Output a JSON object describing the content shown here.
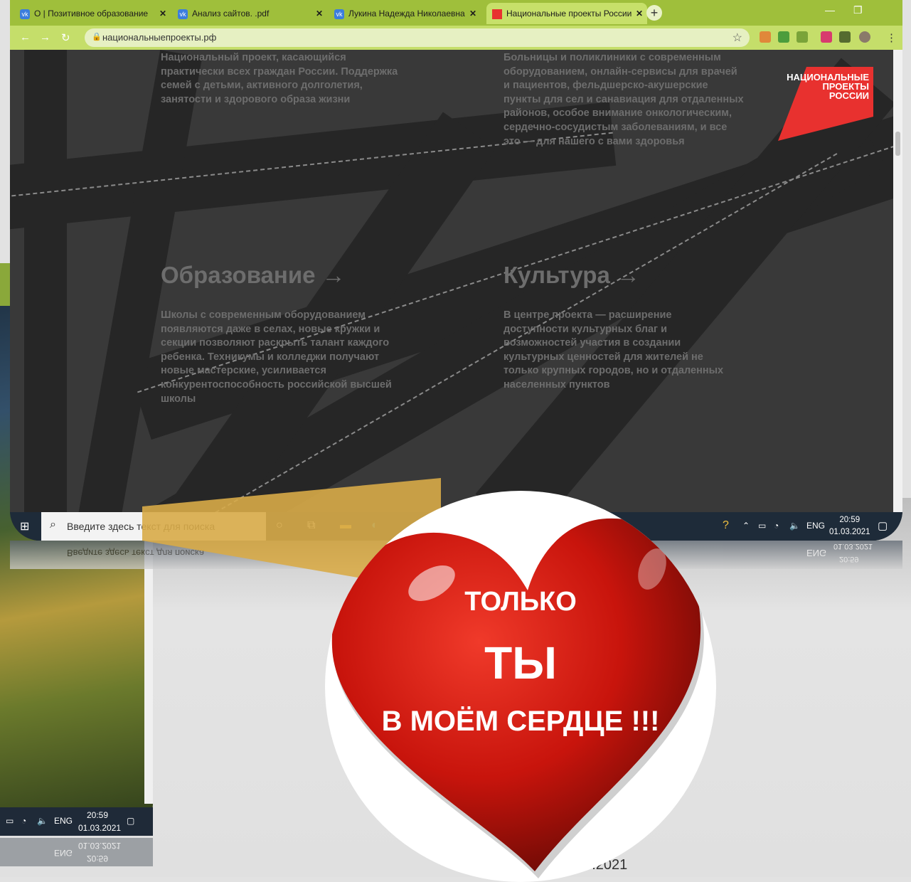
{
  "browser": {
    "tabs": [
      {
        "icon": "vk-icon",
        "label": "О | Позитивное образование",
        "close": "✕"
      },
      {
        "icon": "vk-icon",
        "label": "Анализ сайтов. .pdf",
        "close": "✕"
      },
      {
        "icon": "vk-icon",
        "label": "Лукина Надежда Николаевна",
        "close": "✕"
      },
      {
        "icon": "flag-icon",
        "label": "Национальные проекты России",
        "close": "✕"
      }
    ],
    "new_tab": "+",
    "url": "национальныепроекты.рф"
  },
  "page": {
    "block1_text": "Национальный проект, касающийся практически всех граждан России. Поддержка семей с детьми, активного долголетия, занятости и здорового образа жизни",
    "block2_text": "Больницы и поликлиники с современным оборудованием, онлайн-сервисы для врачей и пациентов, фельдшерско-акушерские пункты для сел и санавиация для отдаленных районов, особое внимание онкологическим, сердечно-сосудистым заболеваниям, и все это — для нашего с вами здоровья",
    "education_title": "Образование →",
    "education_text": "Школы с современным оборудованием появляются даже в селах, новые кружки и секции позволяют раскрыть талант каждого ребенка. Техникумы и колледжи получают новые мастерские, усиливается конкурентоспособность российской высшей школы",
    "culture_title": "Культура →",
    "culture_text": "В центре проекта — расширение доступности культурных благ и возможностей участия в создании культурных ценностей для жителей не только крупных городов, но и отдаленных населенных пунктов",
    "logo_lines": [
      "НАЦИОНАЛЬНЫЕ",
      "ПРОЕКТЫ",
      "РОССИИ"
    ]
  },
  "taskbar": {
    "search_placeholder": "Введите здесь текст для поиска",
    "lang": "ENG",
    "time": "20:59",
    "date": "01.03.2021"
  },
  "back_window": {
    "lang": "ENG",
    "time": "20:59",
    "date": "01.03.2021",
    "date_fragment": "03.2021"
  },
  "heart": {
    "line1": "ТОЛЬКО",
    "line2": "ТЫ",
    "line3": "В МОЁМ СЕРДЦЕ !!!"
  },
  "colors": {
    "browser_frame": "#9fbf3b",
    "heart_red": "#d2180f",
    "logo_red": "#e8312f"
  }
}
